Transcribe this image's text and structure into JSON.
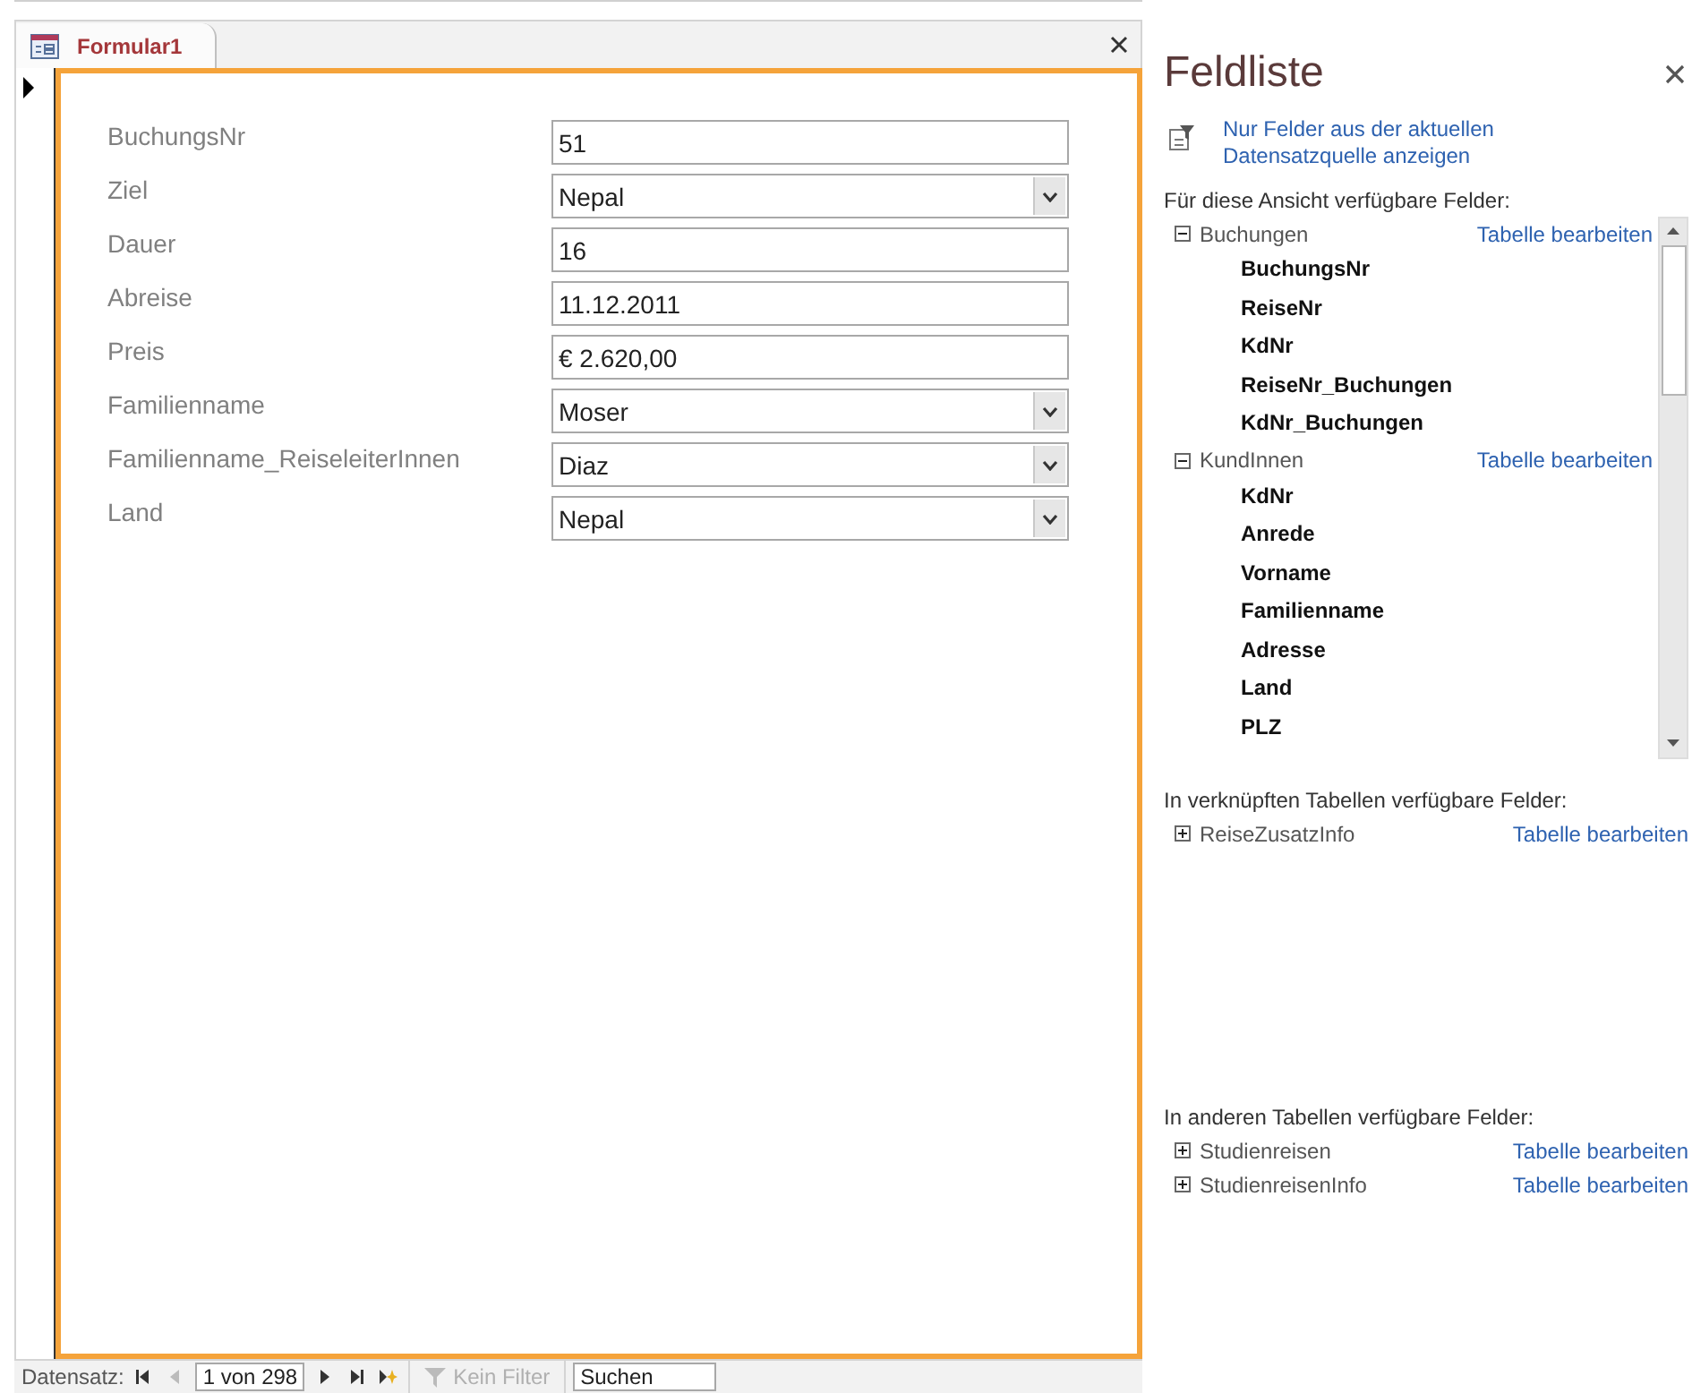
{
  "document_tab": {
    "label": "Formular1",
    "selected": true
  },
  "form": {
    "fields": [
      {
        "label": "BuchungsNr",
        "value": "51",
        "kind": "text"
      },
      {
        "label": "Ziel",
        "value": "Nepal",
        "kind": "combo"
      },
      {
        "label": "Dauer",
        "value": "16",
        "kind": "text"
      },
      {
        "label": "Abreise",
        "value": "11.12.2011",
        "kind": "text"
      },
      {
        "label": "Preis",
        "value": "€ 2.620,00",
        "kind": "text"
      },
      {
        "label": "Familienname",
        "value": "Moser",
        "kind": "combo"
      },
      {
        "label": "Familienname_ReiseleiterInnen",
        "value": "Diaz",
        "kind": "combo"
      },
      {
        "label": "Land",
        "value": "Nepal",
        "kind": "combo"
      }
    ]
  },
  "nav_bar": {
    "label": "Datensatz:",
    "record": "1 von 298",
    "filter": {
      "label": "Kein Filter",
      "disabled": true
    },
    "search": {
      "value": "Suchen"
    }
  },
  "field_list": {
    "title": "Feldliste",
    "link": "Nur Felder aus der aktuellen Datensatzquelle anzeigen",
    "sections": [
      {
        "heading": "Für diese Ansicht verfügbare Felder:",
        "kind": "scroll_list",
        "tables": [
          {
            "name": "Buchungen",
            "expanded": true,
            "action": "Tabelle bearbeiten",
            "children": [
              {
                "name": "BuchungsNr"
              },
              {
                "name": "ReiseNr"
              },
              {
                "name": "KdNr"
              },
              {
                "name": "ReiseNr_Buchungen"
              },
              {
                "name": "KdNr_Buchungen"
              }
            ]
          },
          {
            "name": "KundInnen",
            "expanded": true,
            "action": "Tabelle bearbeiten",
            "children": [
              {
                "name": "KdNr"
              },
              {
                "name": "Anrede"
              },
              {
                "name": "Vorname"
              },
              {
                "name": "Familienname"
              },
              {
                "name": "Adresse"
              },
              {
                "name": "Land"
              },
              {
                "name": "PLZ"
              }
            ]
          }
        ]
      },
      {
        "heading": "In verknüpften Tabellen verfügbare Felder:",
        "kind": "plain",
        "tables": [
          {
            "name": "ReiseZusatzInfo",
            "expanded": false,
            "action": "Tabelle bearbeiten"
          }
        ]
      },
      {
        "heading": "In anderen Tabellen verfügbare Felder:",
        "kind": "plain",
        "tables": [
          {
            "name": "Studienreisen",
            "expanded": false,
            "action": "Tabelle bearbeiten"
          },
          {
            "name": "StudienreisenInfo",
            "expanded": false,
            "action": "Tabelle bearbeiten"
          }
        ]
      }
    ]
  }
}
